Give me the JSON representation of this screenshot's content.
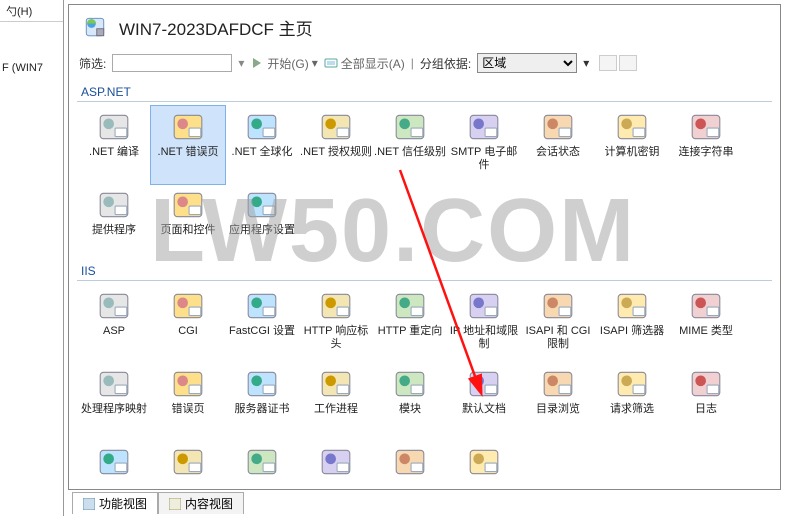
{
  "left": {
    "header": "勺(H)",
    "tree": "F (WIN7"
  },
  "header": {
    "title": "WIN7-2023DAFDCF 主页"
  },
  "toolbar": {
    "filter_label": "筛选:",
    "filter_value": "",
    "go_label": "开始(G)",
    "showall_label": "全部显示(A)",
    "groupby_label": "分组依据:",
    "groupby_value": "区域"
  },
  "groups": {
    "aspnet": {
      "label": "ASP.NET",
      "items": [
        {
          "label": ".NET 编译"
        },
        {
          "label": ".NET 错误页",
          "selected": true
        },
        {
          "label": ".NET 全球化"
        },
        {
          "label": ".NET 授权规则"
        },
        {
          "label": ".NET 信任级别"
        },
        {
          "label": "SMTP 电子邮件"
        },
        {
          "label": "会话状态"
        },
        {
          "label": "计算机密钥"
        },
        {
          "label": "连接字符串"
        },
        {
          "label": "提供程序"
        },
        {
          "label": "页面和控件"
        },
        {
          "label": "应用程序设置"
        }
      ]
    },
    "iis": {
      "label": "IIS",
      "items": [
        {
          "label": "ASP"
        },
        {
          "label": "CGI"
        },
        {
          "label": "FastCGI 设置"
        },
        {
          "label": "HTTP 响应标头"
        },
        {
          "label": "HTTP 重定向"
        },
        {
          "label": "IP 地址和域限制"
        },
        {
          "label": "ISAPI 和 CGI 限制"
        },
        {
          "label": "ISAPI 筛选器"
        },
        {
          "label": "MIME 类型"
        },
        {
          "label": "处理程序映射"
        },
        {
          "label": "错误页"
        },
        {
          "label": "服务器证书"
        },
        {
          "label": "工作进程"
        },
        {
          "label": "模块"
        },
        {
          "label": "默认文档"
        },
        {
          "label": "目录浏览"
        },
        {
          "label": "请求筛选"
        },
        {
          "label": "日志"
        }
      ],
      "row4_count": 6
    }
  },
  "tabs": {
    "features": "功能视图",
    "content": "内容视图"
  },
  "watermark": "LW50.COM"
}
